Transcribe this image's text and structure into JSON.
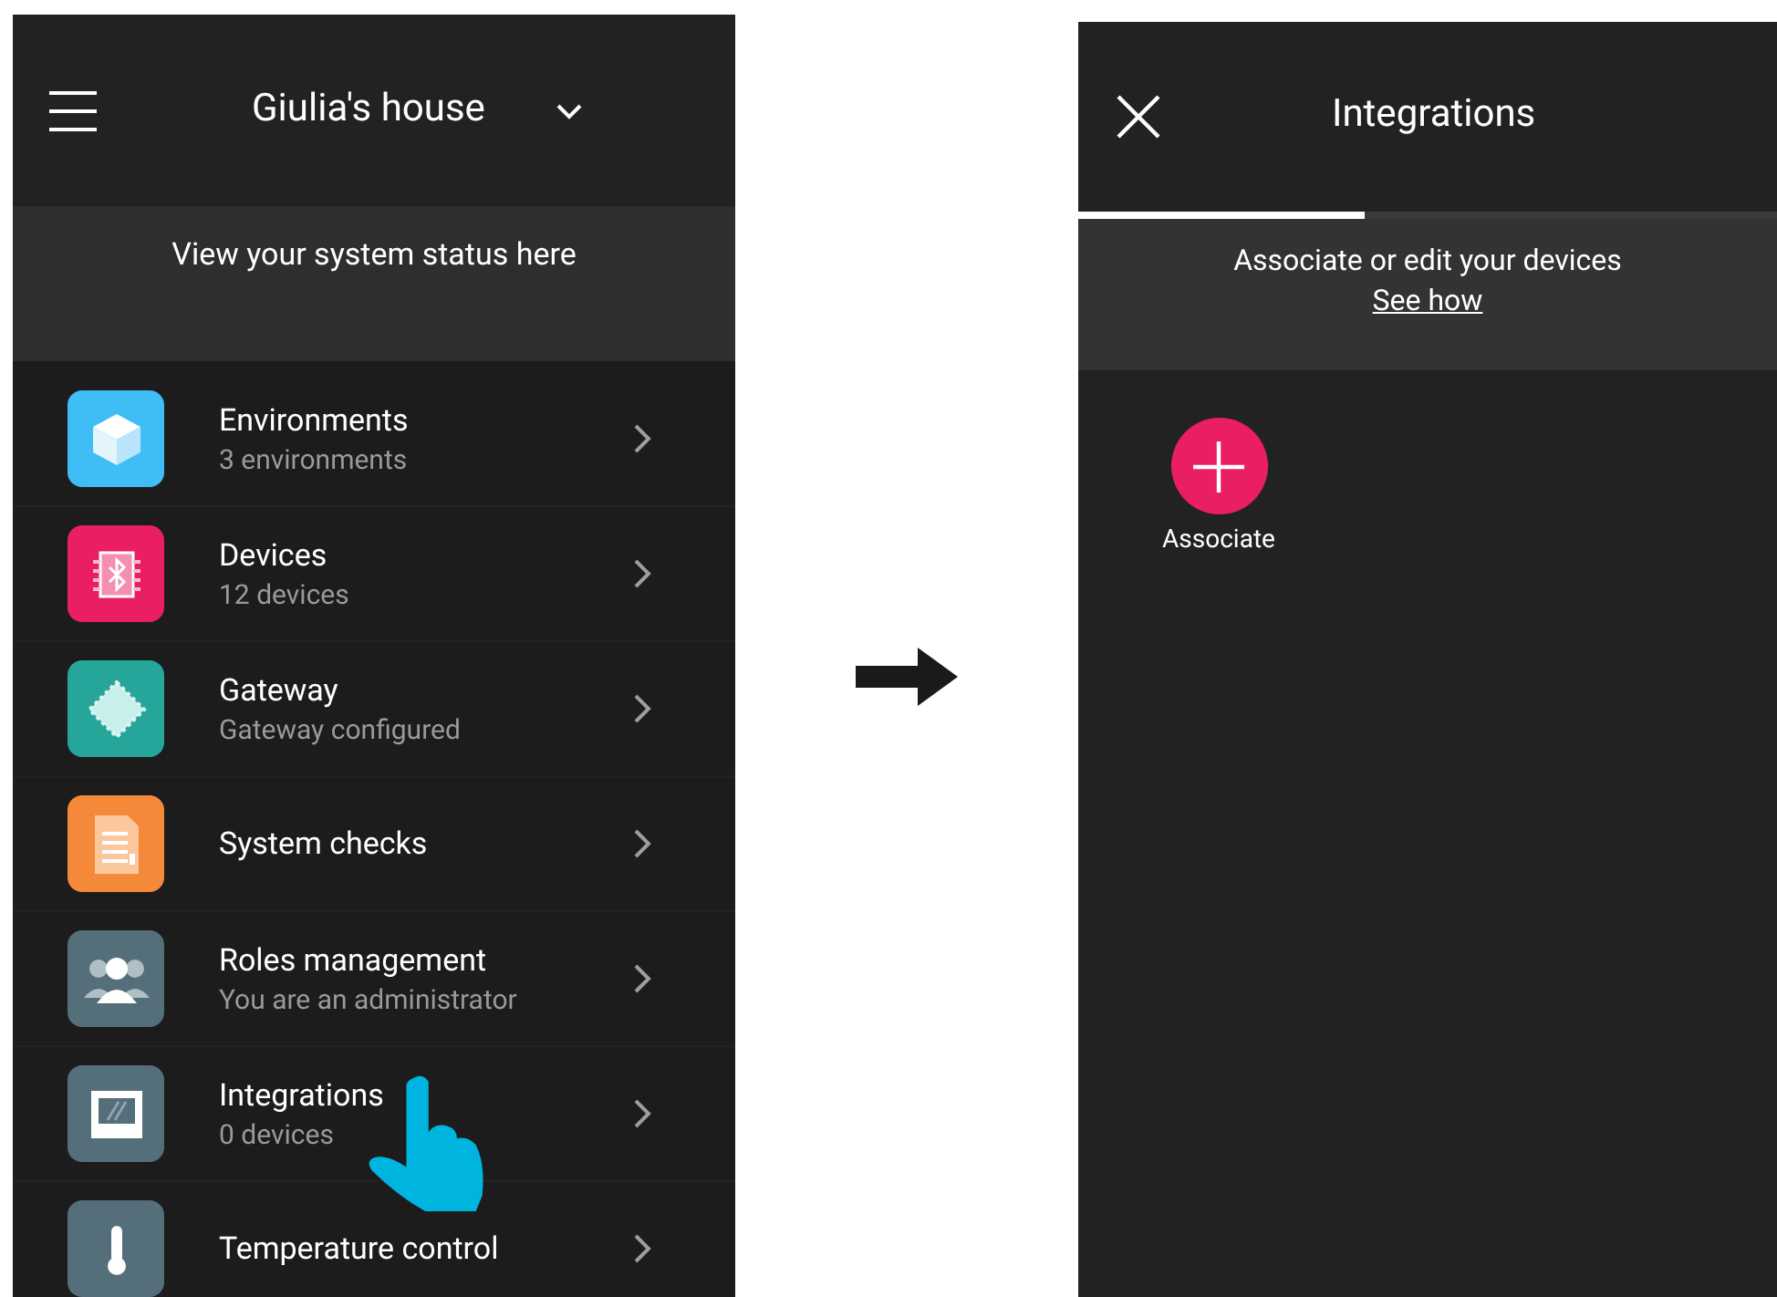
{
  "home_screen": {
    "header": {
      "title": "Giulia's house"
    },
    "status_banner": {
      "text": "View your system status here"
    },
    "menu_items": [
      {
        "kind": "cube",
        "color": "#3fbdf5",
        "title": "Environments",
        "subtitle": "3 environments"
      },
      {
        "kind": "chip",
        "color": "#e91e63",
        "title": "Devices",
        "subtitle": "12 devices"
      },
      {
        "kind": "gateway",
        "color": "#26a69a",
        "title": "Gateway",
        "subtitle": "Gateway configured"
      },
      {
        "kind": "report",
        "color": "#f5893a",
        "title": "System checks"
      },
      {
        "kind": "users",
        "color": "#546e7a",
        "title": "Roles management",
        "subtitle": "You are an administrator"
      },
      {
        "kind": "frame",
        "color": "#546e7a",
        "title": "Integrations",
        "subtitle": "0 devices"
      },
      {
        "kind": "thermo",
        "color": "#546e7a",
        "title": "Temperature control"
      }
    ]
  },
  "integrations_screen": {
    "header": {
      "title": "Integrations"
    },
    "tab_indicator": {
      "level": 0.41
    },
    "banner": {
      "text": "Associate or edit your devices",
      "link": "See how"
    },
    "associate_button": {
      "label": "Associate"
    }
  }
}
